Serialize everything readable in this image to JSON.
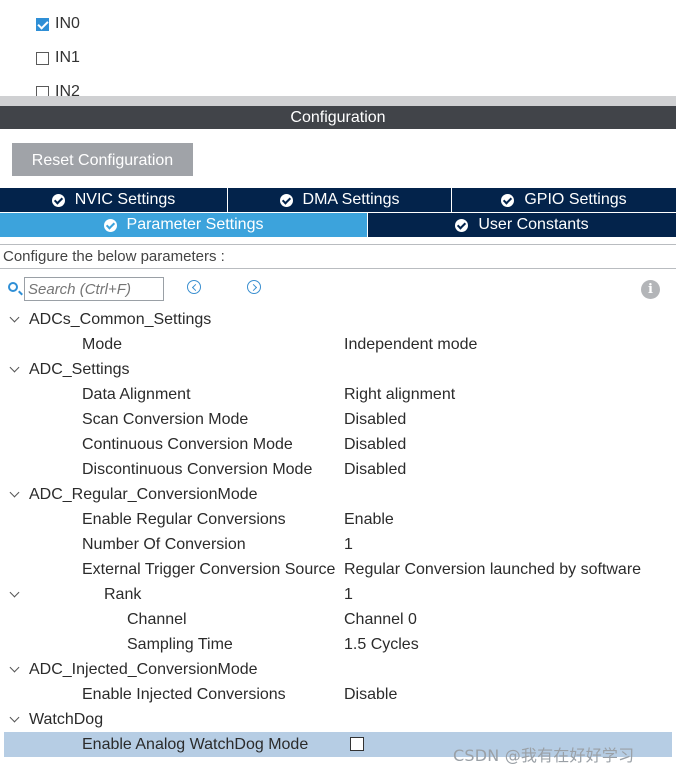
{
  "channels": [
    {
      "label": "IN0",
      "checked": true
    },
    {
      "label": "IN1",
      "checked": false
    },
    {
      "label": "IN2",
      "checked": false
    }
  ],
  "configuration_title": "Configuration",
  "reset_button": "Reset Configuration",
  "tabs_row1": [
    {
      "label": "NVIC Settings",
      "active": false
    },
    {
      "label": "DMA Settings",
      "active": false
    },
    {
      "label": "GPIO Settings",
      "active": false
    }
  ],
  "tabs_row2": [
    {
      "label": "Parameter Settings",
      "active": true
    },
    {
      "label": "User Constants",
      "active": false
    }
  ],
  "configure_label": "Configure the below parameters :",
  "search": {
    "placeholder": "Search (Ctrl+F)"
  },
  "params": [
    {
      "name": "ADCs_Common_Settings",
      "group": true
    },
    {
      "name": "Mode",
      "value": "Independent mode"
    },
    {
      "name": "ADC_Settings",
      "group": true
    },
    {
      "name": "Data Alignment",
      "value": "Right alignment"
    },
    {
      "name": "Scan Conversion Mode",
      "value": "Disabled"
    },
    {
      "name": "Continuous Conversion Mode",
      "value": "Disabled"
    },
    {
      "name": "Discontinuous Conversion Mode",
      "value": "Disabled"
    },
    {
      "name": "ADC_Regular_ConversionMode",
      "group": true
    },
    {
      "name": "Enable Regular Conversions",
      "value": "Enable"
    },
    {
      "name": "Number Of Conversion",
      "value": "1"
    },
    {
      "name": "External Trigger Conversion Source",
      "value": "Regular Conversion launched by software"
    },
    {
      "name": "Rank",
      "value": "1"
    },
    {
      "name": "Channel",
      "value": "Channel 0"
    },
    {
      "name": "Sampling Time",
      "value": "1.5 Cycles"
    },
    {
      "name": "ADC_Injected_ConversionMode",
      "group": true
    },
    {
      "name": "Enable Injected Conversions",
      "value": "Disable"
    },
    {
      "name": "WatchDog",
      "group": true
    },
    {
      "name": "Enable Analog WatchDog Mode",
      "checkbox": true,
      "checked": false,
      "selected": true
    }
  ],
  "watermark": "CSDN @我有在好好学习"
}
